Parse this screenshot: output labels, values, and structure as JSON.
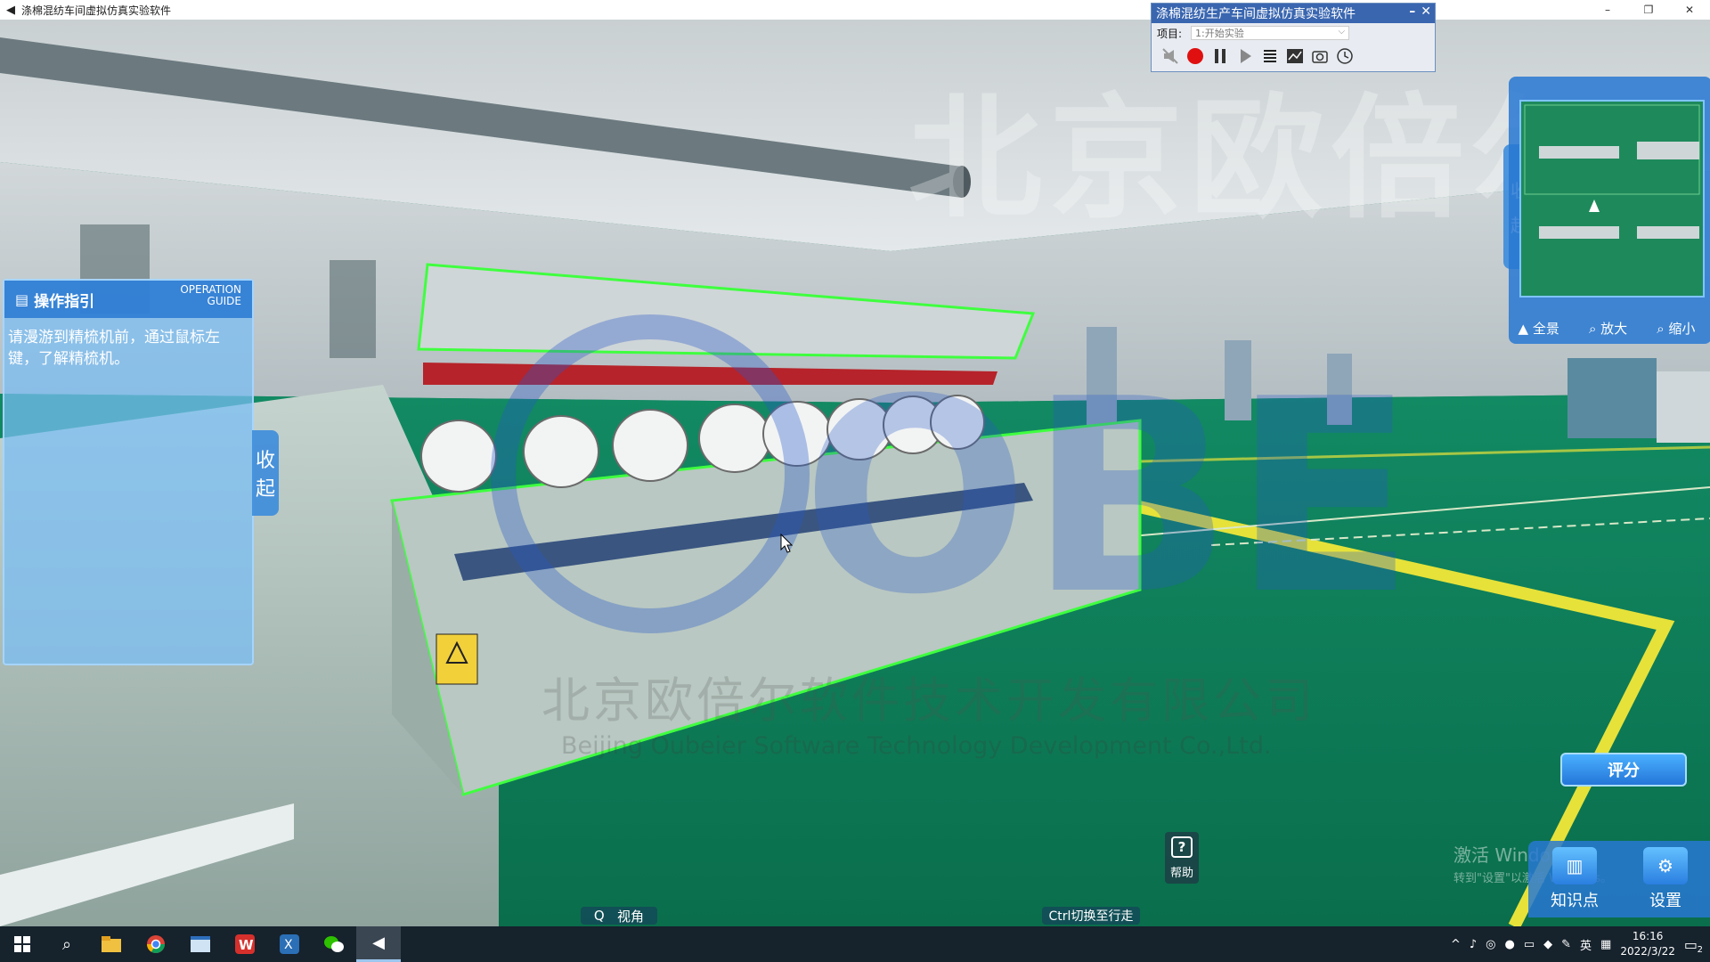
{
  "window": {
    "title": "涤棉混纺车间虚拟仿真实验软件",
    "minimize": "–",
    "restore": "❐",
    "close": "✕"
  },
  "control_panel": {
    "title": "涤棉混纺生产车间虚拟仿真实验软件",
    "minimize": "–",
    "close": "✕",
    "project_label": "项目:",
    "project_value": "1:开始实验",
    "tools": [
      "mute-icon",
      "record-icon",
      "pause-icon",
      "play-icon",
      "list-icon",
      "chart-icon",
      "camera-icon",
      "clock-icon"
    ]
  },
  "watermark": {
    "top_cn": "北京欧倍尔",
    "logo": "OBE",
    "company_cn": "北京欧倍尔软件技术开发有限公司",
    "company_en": "Beijing Oubeier Software Technology Development Co.,Ltd."
  },
  "minimap": {
    "collapse_label_1": "收",
    "collapse_label_2": "起",
    "full_view": "全景",
    "zoom_in": "放大",
    "zoom_out": "缩小"
  },
  "guide": {
    "title": "操作指引",
    "title_en_1": "OPERATION",
    "title_en_2": "GUIDE",
    "text": "请漫游到精梳机前，通过鼠标左键，了解精梳机。",
    "collapse_label_1": "收",
    "collapse_label_2": "起"
  },
  "hud": {
    "view_label": "视角",
    "view_key": "Q",
    "walk_hint": "Ctrl切换至行走",
    "help_label": "帮助",
    "score_label": "评分",
    "knowledge_label": "知识点",
    "settings_label": "设置"
  },
  "activation": {
    "line1": "激活 Windows",
    "line2": "转到\"设置\"以激活 Windows。"
  },
  "taskbar": {
    "ime": "英",
    "time": "16:16",
    "date": "2022/3/22",
    "notification_count": "2"
  }
}
